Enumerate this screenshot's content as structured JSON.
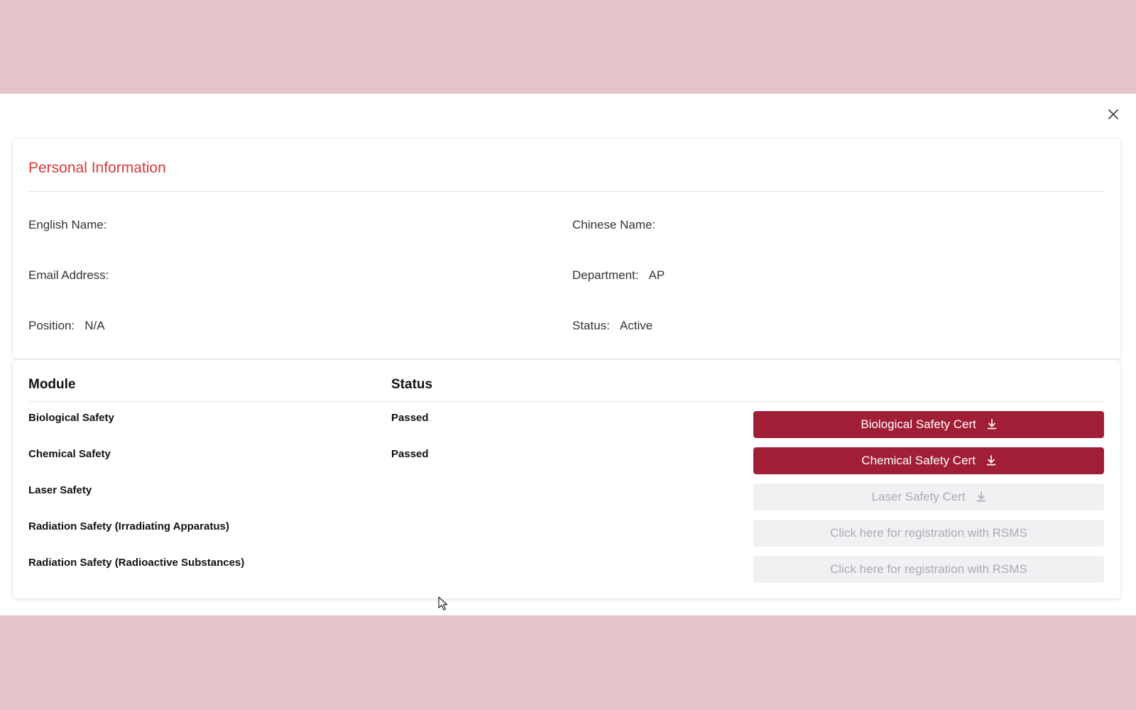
{
  "modal": {
    "close_icon": "close-icon"
  },
  "personal_info": {
    "title": "Personal Information",
    "fields": {
      "english_name": {
        "label": "English Name:",
        "value": ""
      },
      "chinese_name": {
        "label": "Chinese Name:",
        "value": ""
      },
      "email": {
        "label": "Email Address:",
        "value": ""
      },
      "department": {
        "label": "Department:",
        "value": "AP"
      },
      "position": {
        "label": "Position:",
        "value": "N/A"
      },
      "status": {
        "label": "Status:",
        "value": "Active"
      }
    }
  },
  "modules": {
    "headers": {
      "module": "Module",
      "status": "Status"
    },
    "rows": [
      {
        "name": "Biological Safety",
        "status": "Passed",
        "button": "Biological Safety Cert",
        "enabled": true,
        "icon": "download-icon"
      },
      {
        "name": "Chemical Safety",
        "status": "Passed",
        "button": "Chemical Safety Cert",
        "enabled": true,
        "icon": "download-icon"
      },
      {
        "name": "Laser Safety",
        "status": "",
        "button": "Laser Safety Cert",
        "enabled": false,
        "icon": "download-icon"
      },
      {
        "name": "Radiation Safety (Irradiating Apparatus)",
        "status": "",
        "button": "Click here for registration with RSMS",
        "enabled": false
      },
      {
        "name": "Radiation Safety (Radioactive Substances)",
        "status": "",
        "button": "Click here for registration with RSMS",
        "enabled": false
      }
    ]
  },
  "colors": {
    "accent": "#a01f36",
    "title_red": "#d93a3a",
    "backdrop": "#e5c4c9",
    "disabled_bg": "#f1f1f3",
    "disabled_text": "#a8acb2"
  }
}
